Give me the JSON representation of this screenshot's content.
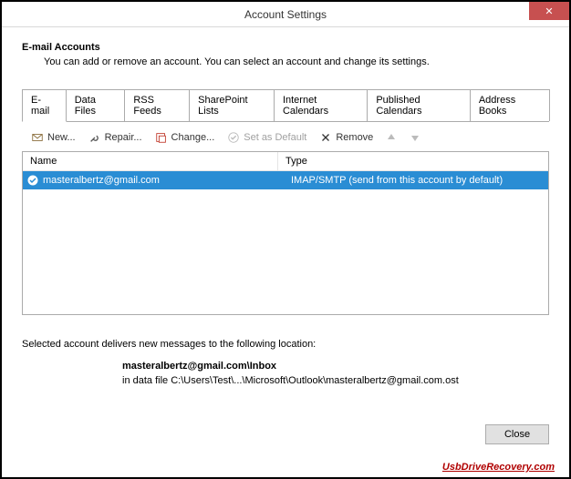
{
  "window": {
    "title": "Account Settings",
    "close_symbol": "✕"
  },
  "header": {
    "heading": "E-mail Accounts",
    "subheading": "You can add or remove an account. You can select an account and change its settings."
  },
  "tabs": [
    {
      "label": "E-mail",
      "active": true
    },
    {
      "label": "Data Files",
      "active": false
    },
    {
      "label": "RSS Feeds",
      "active": false
    },
    {
      "label": "SharePoint Lists",
      "active": false
    },
    {
      "label": "Internet Calendars",
      "active": false
    },
    {
      "label": "Published Calendars",
      "active": false
    },
    {
      "label": "Address Books",
      "active": false
    }
  ],
  "toolbar": {
    "new_label": "New...",
    "repair_label": "Repair...",
    "change_label": "Change...",
    "default_label": "Set as Default",
    "remove_label": "Remove"
  },
  "list": {
    "col_name": "Name",
    "col_type": "Type",
    "rows": [
      {
        "name": "masteralbertz@gmail.com",
        "type": "IMAP/SMTP (send from this account by default)"
      }
    ]
  },
  "footer": {
    "line1": "Selected account delivers new messages to the following location:",
    "line2": "masteralbertz@gmail.com\\Inbox",
    "line3": "in data file C:\\Users\\Test\\...\\Microsoft\\Outlook\\masteralbertz@gmail.com.ost"
  },
  "buttons": {
    "close": "Close"
  },
  "watermark": "UsbDriveRecovery.com"
}
